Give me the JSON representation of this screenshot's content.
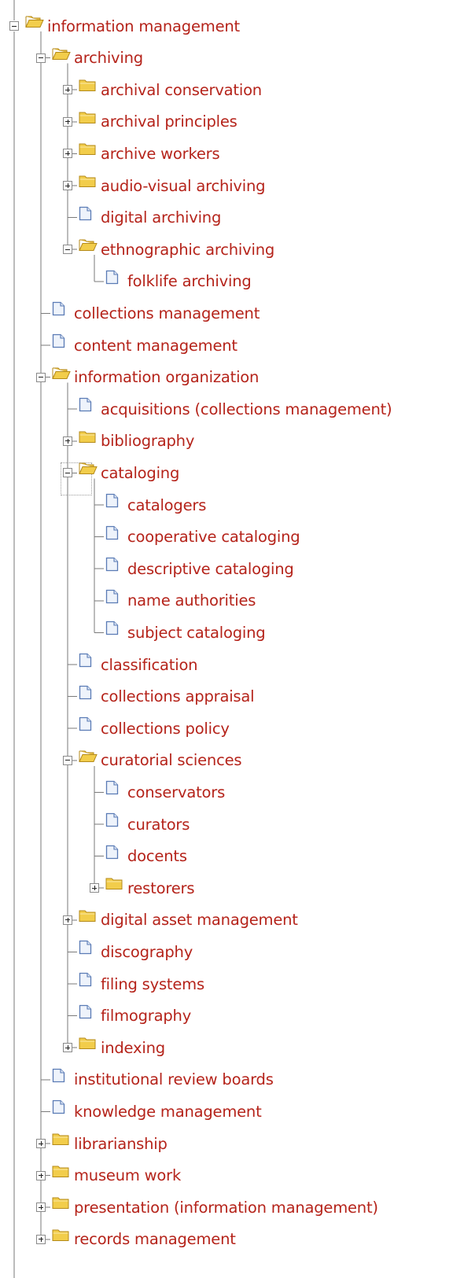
{
  "colors": {
    "label": "#b5231a",
    "line": "#7a7a7a",
    "folder": "#f2cd4b",
    "document": "#5a7bb5"
  },
  "tree": {
    "root": {
      "label": "information management",
      "icon": "folder-open-icon",
      "toggle": "minus",
      "children": [
        {
          "label": "archiving",
          "icon": "folder-open-icon",
          "toggle": "minus",
          "children": [
            {
              "label": "archival conservation",
              "icon": "folder-icon",
              "toggle": "plus"
            },
            {
              "label": "archival principles",
              "icon": "folder-icon",
              "toggle": "plus"
            },
            {
              "label": "archive workers",
              "icon": "folder-icon",
              "toggle": "plus"
            },
            {
              "label": "audio-visual archiving",
              "icon": "folder-icon",
              "toggle": "plus"
            },
            {
              "label": "digital archiving",
              "icon": "document-icon"
            },
            {
              "label": "ethnographic archiving",
              "icon": "folder-open-icon",
              "toggle": "minus",
              "children": [
                {
                  "label": "folklife archiving",
                  "icon": "document-icon"
                }
              ]
            }
          ]
        },
        {
          "label": "collections management",
          "icon": "document-icon"
        },
        {
          "label": "content management",
          "icon": "document-icon"
        },
        {
          "label": "information organization",
          "icon": "folder-open-icon",
          "toggle": "minus",
          "children": [
            {
              "label": "acquisitions (collections management)",
              "icon": "document-icon"
            },
            {
              "label": "bibliography",
              "icon": "folder-icon",
              "toggle": "plus"
            },
            {
              "label": "cataloging",
              "icon": "folder-open-icon",
              "toggle": "minus",
              "focused": true,
              "children": [
                {
                  "label": "catalogers",
                  "icon": "document-icon"
                },
                {
                  "label": "cooperative cataloging",
                  "icon": "document-icon"
                },
                {
                  "label": "descriptive cataloging",
                  "icon": "document-icon"
                },
                {
                  "label": "name authorities",
                  "icon": "document-icon"
                },
                {
                  "label": "subject cataloging",
                  "icon": "document-icon"
                }
              ]
            },
            {
              "label": "classification",
              "icon": "document-icon"
            },
            {
              "label": "collections appraisal",
              "icon": "document-icon"
            },
            {
              "label": "collections policy",
              "icon": "document-icon"
            },
            {
              "label": "curatorial sciences",
              "icon": "folder-open-icon",
              "toggle": "minus",
              "children": [
                {
                  "label": "conservators",
                  "icon": "document-icon"
                },
                {
                  "label": "curators",
                  "icon": "document-icon"
                },
                {
                  "label": "docents",
                  "icon": "document-icon"
                },
                {
                  "label": "restorers",
                  "icon": "folder-icon",
                  "toggle": "plus"
                }
              ]
            },
            {
              "label": "digital asset management",
              "icon": "folder-icon",
              "toggle": "plus"
            },
            {
              "label": "discography",
              "icon": "document-icon"
            },
            {
              "label": "filing systems",
              "icon": "document-icon"
            },
            {
              "label": "filmography",
              "icon": "document-icon"
            },
            {
              "label": "indexing",
              "icon": "folder-icon",
              "toggle": "plus"
            }
          ]
        },
        {
          "label": "institutional review boards",
          "icon": "document-icon"
        },
        {
          "label": "knowledge management",
          "icon": "document-icon"
        },
        {
          "label": "librarianship",
          "icon": "folder-icon",
          "toggle": "plus"
        },
        {
          "label": "museum work",
          "icon": "folder-icon",
          "toggle": "plus"
        },
        {
          "label": "presentation (information management)",
          "icon": "folder-icon",
          "toggle": "plus"
        },
        {
          "label": "records management",
          "icon": "folder-icon",
          "toggle": "plus"
        }
      ]
    }
  }
}
